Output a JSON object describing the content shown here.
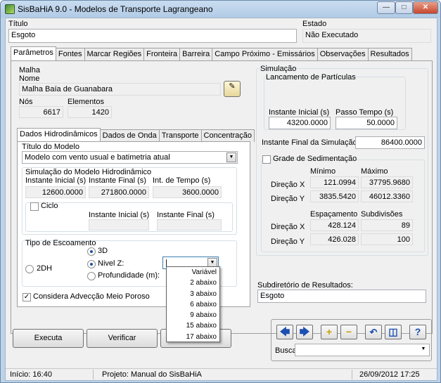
{
  "window": {
    "title": "SisBaHiA 9.0 - Modelos de Transporte Lagrangeano"
  },
  "header": {
    "titulo_label": "Título",
    "titulo_value": "Esgoto",
    "estado_label": "Estado",
    "estado_value": "Não Executado"
  },
  "tabs": [
    "Parâmetros",
    "Fontes",
    "Marcar Regiões",
    "Fronteira",
    "Barreira",
    "Campo Próximo - Emissários",
    "Observações",
    "Resultados"
  ],
  "malha": {
    "group_label": "Malha",
    "nome_label": "Nome",
    "nome_value": "Malha Baía de Guanabara",
    "nos_label": "Nós",
    "nos_value": "6617",
    "elementos_label": "Elementos",
    "elementos_value": "1420"
  },
  "subtabs": [
    "Dados Hidrodinâmicos",
    "Dados de Onda",
    "Transporte",
    "Concentração"
  ],
  "hidro": {
    "titulo_modelo_label": "Título do Modelo",
    "titulo_modelo_value": "Modelo com vento usual e batimetria atual",
    "sim_group_label": "Simulação do Modelo Hidrodinâmico",
    "inst_inicial_label": "Instante Inicial (s)",
    "inst_inicial_value": "12600.0000",
    "inst_final_label": "Instante Final (s)",
    "inst_final_value": "271800.0000",
    "int_tempo_label": "Int. de Tempo (s)",
    "int_tempo_value": "3600.0000",
    "ciclo_label": "Ciclo",
    "ciclo_ini_label": "Instante Inicial (s)",
    "ciclo_fim_label": "Instante Final (s)",
    "escoamento_label": "Tipo de Escoamento",
    "opt_3d": "3D",
    "opt_2dh": "2DH",
    "opt_nivel": "Nivel Z:",
    "opt_prof": "Profundidade (m):",
    "nivel_value": "|",
    "advec_label": "Considera Advecção Meio Poroso"
  },
  "dropdown_options": [
    "Variável",
    "2 abaixo",
    "3 abaixo",
    "6 abaixo",
    "9 abaixo",
    "15 abaixo",
    "17 abaixo"
  ],
  "simulacao": {
    "group_label": "Simulação",
    "lanc_label": "Lancamento de Partículas",
    "inst_inicial_label": "Instante Inicial (s)",
    "inst_inicial_value": "43200.0000",
    "passo_label": "Passo Tempo (s)",
    "passo_value": "50.0000",
    "inst_final_label": "Instante Final da Simulação (s):",
    "inst_final_value": "86400.0000"
  },
  "grade": {
    "label": "Grade de Sedimentação",
    "minimo_label": "Mínimo",
    "maximo_label": "Máximo",
    "dirx_label": "Direção X",
    "diry_label": "Direção Y",
    "min_x": "121.0994",
    "max_x": "37795.9680",
    "min_y": "3835.5420",
    "max_y": "46012.3360",
    "espac_label": "Espaçamento",
    "subdiv_label": "Subdivisões",
    "esp_x": "428.124",
    "sub_x": "89",
    "esp_y": "426.028",
    "sub_y": "100"
  },
  "subdir": {
    "label": "Subdiretório de Resultados:",
    "value": "Esgoto"
  },
  "buttons": {
    "executa": "Executa",
    "verificar": "Verificar"
  },
  "nav": {
    "busca_label": "Busca:"
  },
  "status": {
    "inicio": "Início: 16:40",
    "projeto": "Projeto: Manual do SisBaHiA",
    "data": "26/09/2012 17:25"
  }
}
